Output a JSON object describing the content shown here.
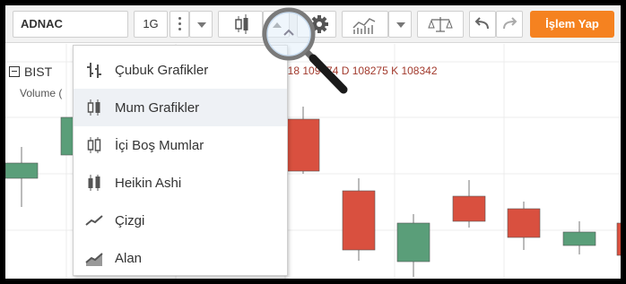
{
  "toolbar": {
    "symbol": "ADNAC",
    "interval": "1G",
    "trade_label": "İşlem Yap",
    "colors": {
      "trade": "#f58220"
    }
  },
  "chart": {
    "symbol_title": "BIST",
    "volume_label": "Volume (",
    "ohlc_text": "618  109474 D 108275 K 108342",
    "colors": {
      "up": "#5a9e79",
      "down": "#d9503f"
    }
  },
  "menu": {
    "items": [
      {
        "label": "Çubuk Grafikler",
        "icon": "bar-chart-icon"
      },
      {
        "label": "Mum Grafikler",
        "icon": "candlestick-icon",
        "selected": true
      },
      {
        "label": "İçi Boş Mumlar",
        "icon": "hollow-candle-icon"
      },
      {
        "label": "Heikin Ashi",
        "icon": "heikin-ashi-icon"
      },
      {
        "label": "Çizgi",
        "icon": "line-chart-icon"
      },
      {
        "label": "Alan",
        "icon": "area-chart-icon"
      }
    ]
  }
}
